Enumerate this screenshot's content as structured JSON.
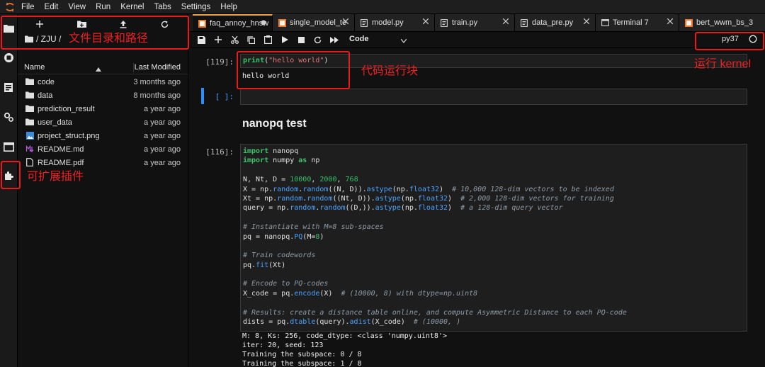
{
  "menubar": {
    "items": [
      "File",
      "Edit",
      "View",
      "Run",
      "Kernel",
      "Tabs",
      "Settings",
      "Help"
    ],
    "logo_icon": "jupyter-logo-icon"
  },
  "activity": {
    "icons": [
      "folder-icon",
      "running-icon",
      "commands-icon",
      "property-inspector-icon",
      "tabs-icon",
      "extension-icon"
    ]
  },
  "filebrowser": {
    "path": "/ ZJU /",
    "col_name": "Name",
    "col_modified": "Last Modified",
    "files": [
      {
        "name": "code",
        "modified": "3 months ago",
        "icon": "folder-icon"
      },
      {
        "name": "data",
        "modified": "8 months ago",
        "icon": "folder-icon"
      },
      {
        "name": "prediction_result",
        "modified": "a year ago",
        "icon": "folder-icon"
      },
      {
        "name": "user_data",
        "modified": "a year ago",
        "icon": "folder-icon"
      },
      {
        "name": "project_struct.png",
        "modified": "a year ago",
        "icon": "image-file-icon"
      },
      {
        "name": "README.md",
        "modified": "a year ago",
        "icon": "markdown-file-icon"
      },
      {
        "name": "README.pdf",
        "modified": "a year ago",
        "icon": "file-icon"
      }
    ]
  },
  "tabs": [
    {
      "label": "faq_annoy_hnsw",
      "icon": "notebook-icon",
      "active": true,
      "dirty": true
    },
    {
      "label": "single_model_te",
      "icon": "notebook-icon",
      "active": false
    },
    {
      "label": "model.py",
      "icon": "python-file-icon",
      "active": false
    },
    {
      "label": "train.py",
      "icon": "python-file-icon",
      "active": false
    },
    {
      "label": "data_pre.py",
      "icon": "python-file-icon",
      "active": false
    },
    {
      "label": "Terminal 7",
      "icon": "terminal-icon",
      "active": false
    },
    {
      "label": "bert_wwm_bs_3",
      "icon": "notebook-icon",
      "active": false
    }
  ],
  "toolbar": {
    "cell_type": "Code",
    "kernel_name": "py37"
  },
  "notebook": {
    "cell1_prompt": "[119]:",
    "cell1_code": "print(\"hello world\")",
    "cell1_output": "hello world",
    "cell2_prompt": "[ ]:",
    "markdown_heading": "nanopq test",
    "cell3_prompt": "[116]:",
    "cell3_output": [
      "M: 8, Ks: 256, code_dtype: <class 'numpy.uint8'>",
      "iter: 20, seed: 123",
      "Training the subspace: 0 / 8",
      "Training the subspace: 1 / 8"
    ]
  },
  "annotations": {
    "file_dir": "文件目录和路径",
    "code_block": "代码运行块",
    "kernel": "运行 kernel",
    "extensions": "可扩展插件",
    "color": "#e81b1b"
  },
  "colors": {
    "keyword": "#3cc36a",
    "function": "#4aa3ff",
    "comment": "#8e9ba8",
    "active_tab": "#f0a33a"
  }
}
